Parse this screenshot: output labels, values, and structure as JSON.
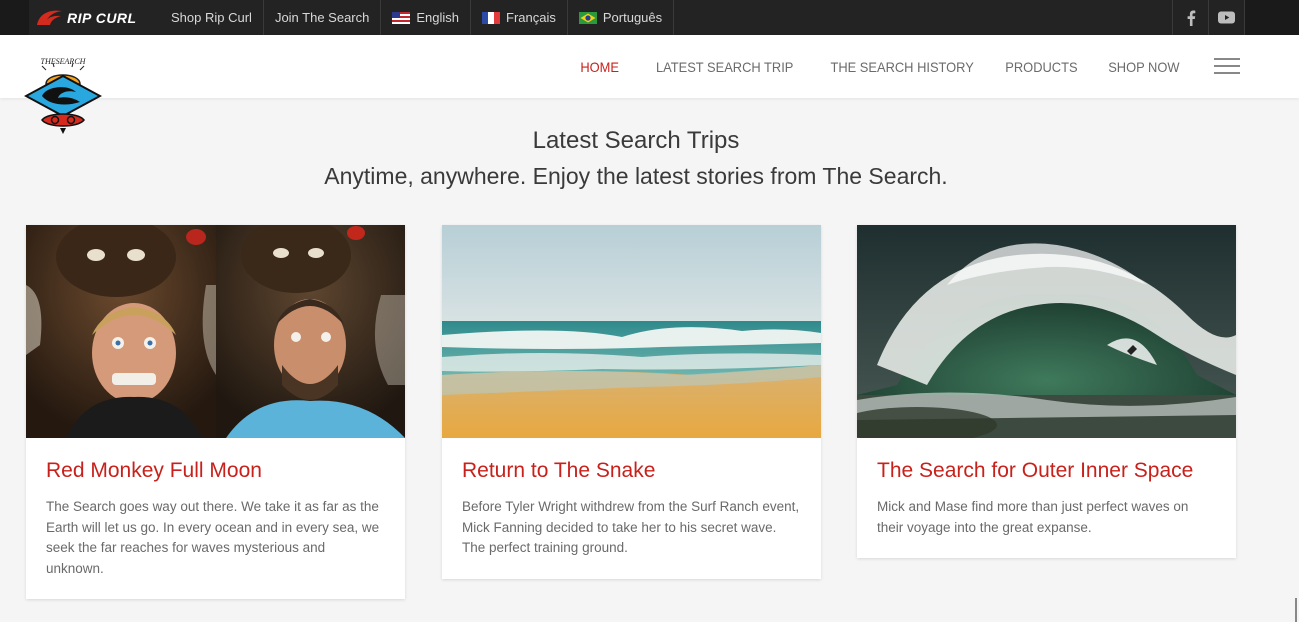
{
  "topbar": {
    "brand": "RIP CURL",
    "links": [
      {
        "label": "Shop Rip Curl"
      },
      {
        "label": "Join The Search"
      },
      {
        "label": "English",
        "flag": "us-flag-icon"
      },
      {
        "label": "Français",
        "flag": "france-flag-icon"
      },
      {
        "label": "Português",
        "flag": "brazil-flag-icon"
      }
    ],
    "social": [
      "facebook-icon",
      "youtube-icon"
    ]
  },
  "nav": {
    "items": [
      "HOME",
      "LATEST SEARCH TRIP",
      "THE SEARCH HISTORY",
      "PRODUCTS",
      "SHOP NOW"
    ],
    "active": "HOME"
  },
  "hero": {
    "title": "Latest Search Trips",
    "subtitle": "Anytime, anywhere. Enjoy the latest stories from The Search."
  },
  "cards": [
    {
      "title": "Red Monkey Full Moon",
      "description": "The Search goes way out there. We take it as far as the Earth will let us go. In every ocean and in every sea, we seek the far reaches for waves mysterious and unknown."
    },
    {
      "title": "Return to The Snake",
      "description": "Before Tyler Wright withdrew from the Surf Ranch event, Mick Fanning decided to take her to his secret wave. The perfect training ground."
    },
    {
      "title": "The Search for Outer Inner Space",
      "description": "Mick and Mase find more than just perfect waves on their voyage into the great expanse."
    }
  ],
  "colors": {
    "accent": "#c8211b",
    "topbar": "#232323",
    "background": "#f5f5f5"
  }
}
